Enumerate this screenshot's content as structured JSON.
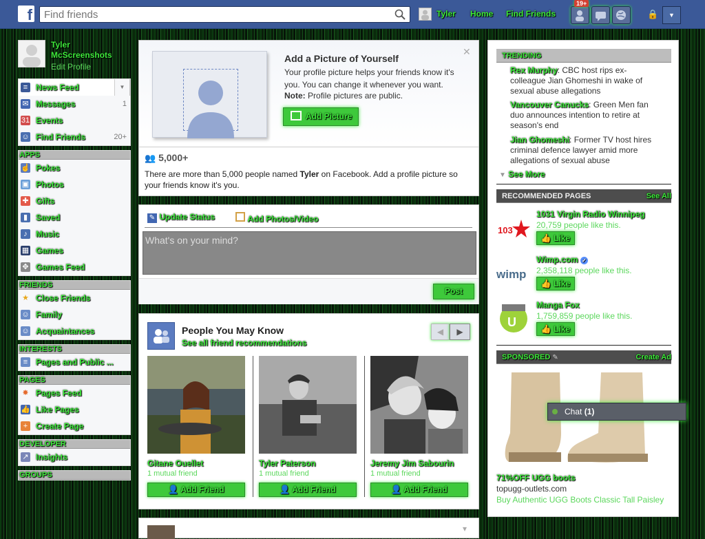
{
  "topbar": {
    "logo": "f",
    "search_placeholder": "Find friends",
    "user": "Tyler",
    "home": "Home",
    "find_friends": "Find Friends",
    "jewel_badge": "19+"
  },
  "profile": {
    "name": "Tyler McScreenshots",
    "edit": "Edit Profile"
  },
  "nav": {
    "main": [
      {
        "label": "News Feed",
        "count": ""
      },
      {
        "label": "Messages",
        "count": "1"
      },
      {
        "label": "Events",
        "count": ""
      },
      {
        "label": "Find Friends",
        "count": "20+"
      }
    ],
    "apps_head": "APPS",
    "apps": [
      "Pokes",
      "Photos",
      "Gifts",
      "Saved",
      "Music",
      "Games",
      "Games Feed"
    ],
    "friends_head": "FRIENDS",
    "friends": [
      "Close Friends",
      "Family",
      "Acquaintances"
    ],
    "interests_head": "INTERESTS",
    "interests": [
      "Pages and Public ..."
    ],
    "pages_head": "PAGES",
    "pages": [
      "Pages Feed",
      "Like Pages",
      "Create Page"
    ],
    "developer_head": "DEVELOPER",
    "developer": [
      "Insights"
    ],
    "groups_head": "GROUPS"
  },
  "addpic": {
    "title": "Add a Picture of Yourself",
    "body": "Your profile picture helps your friends know it's you. You can change it whenever you want.",
    "note_label": "Note:",
    "note": "Profile pictures are public.",
    "button": "Add Picture",
    "count": "5,000+",
    "info_pre": "There are more than 5,000 people named",
    "info_name": "Tyler",
    "info_post": "on Facebook. Add a profile picture so your friends know it's you."
  },
  "composer": {
    "update_status": "Update Status",
    "add_photos": "Add Photos/Video",
    "placeholder": "What's on your mind?",
    "post": "Post"
  },
  "pymk": {
    "title": "People You May Know",
    "subtitle": "See all friend recommendations",
    "add_friend": "Add Friend",
    "people": [
      {
        "name": "Gitane Ouellet",
        "mutual": "1 mutual friend"
      },
      {
        "name": "Tyler Paterson",
        "mutual": "1 mutual friend"
      },
      {
        "name": "Jeremy Jim Sabourin",
        "mutual": "1 mutual friend"
      }
    ]
  },
  "trending": {
    "head": "TRENDING",
    "items": [
      {
        "topic": "Rex Murphy",
        "text": ": CBC host rips ex-colleague Jian Ghomeshi in wake of sexual abuse allegations"
      },
      {
        "topic": "Vancouver Canucks",
        "text": ": Green Men fan duo announces intention to retire at season's end"
      },
      {
        "topic": "Jian Ghomeshi",
        "text": ": Former TV host hires criminal defence lawyer amid more allegations of sexual abuse"
      }
    ],
    "see_more": "See More"
  },
  "recommended": {
    "head": "RECOMMENDED PAGES",
    "see_all": "See All",
    "like": "Like",
    "pages": [
      {
        "name": "1031 Virgin Radio Winnipeg",
        "likes": "20,759 people like this."
      },
      {
        "name": "Wimp.com",
        "likes": "2,358,118 people like this."
      },
      {
        "name": "Manga Fox",
        "likes": "1,759,859 people like this."
      }
    ]
  },
  "sponsored": {
    "head": "SPONSORED",
    "create_ad": "Create Ad",
    "ad_title": "71%OFF UGG boots",
    "ad_url": "topugg-outlets.com",
    "ad_body": "Buy Authentic UGG Boots Classic Tall Paisley"
  },
  "chat": {
    "label": "Chat",
    "count": "(1)"
  }
}
